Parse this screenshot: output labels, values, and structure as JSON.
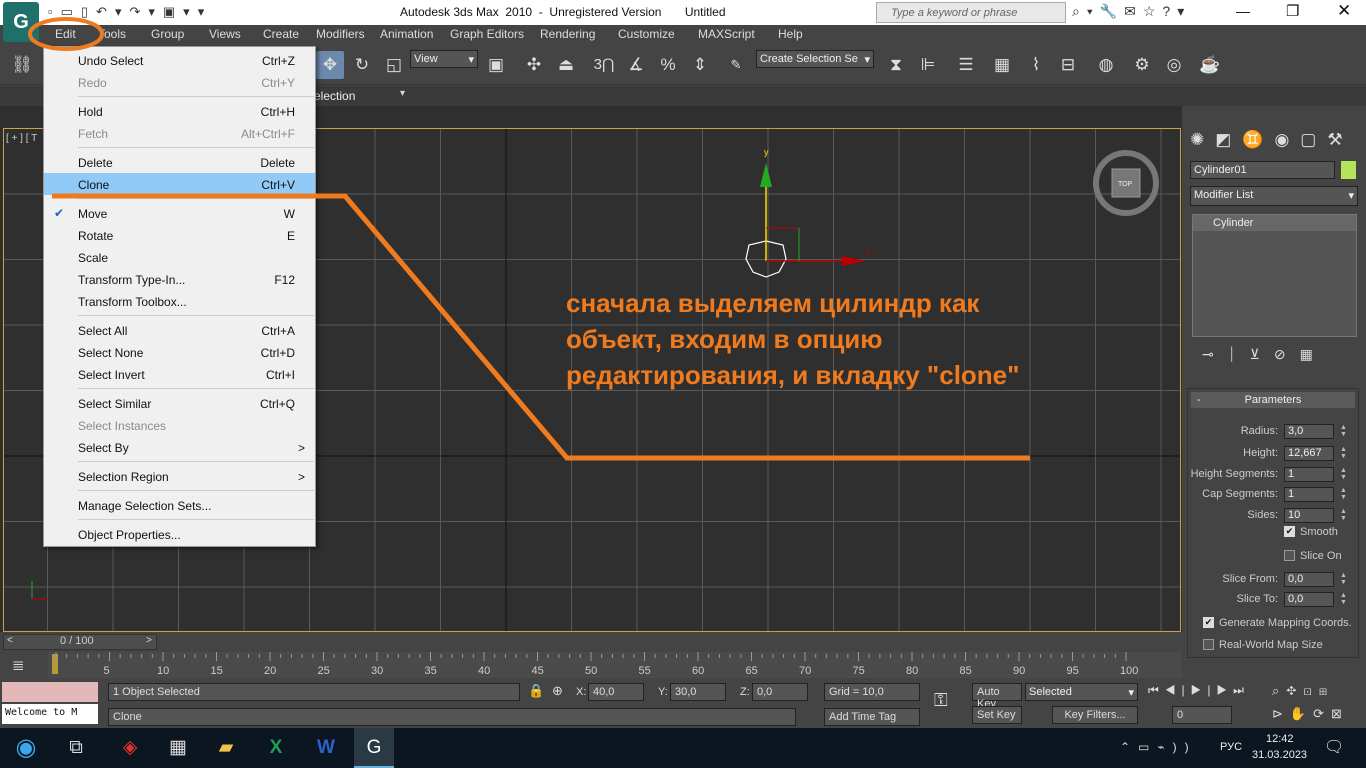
{
  "app": {
    "title": "Autodesk 3ds Max  2010  -  Unregistered Version       Untitled",
    "search_placeholder": "Type a keyword or phrase"
  },
  "menubar": [
    "Edit",
    "Tools",
    "Group",
    "Views",
    "Create",
    "Modifiers",
    "Animation",
    "Graph Editors",
    "Rendering",
    "Customize",
    "MAXScript",
    "Help"
  ],
  "toolbar": {
    "view_dropdown": "View",
    "selection_set": "Create Selection Se",
    "snap_label": "3",
    "ribbon_label": "Selection"
  },
  "edit_menu": [
    {
      "label": "Undo Select",
      "shortcut": "Ctrl+Z"
    },
    {
      "label": "Redo",
      "shortcut": "Ctrl+Y",
      "disabled": true
    },
    {
      "label": "Hold",
      "shortcut": "Ctrl+H"
    },
    {
      "label": "Fetch",
      "shortcut": "Alt+Ctrl+F",
      "disabled": true
    },
    {
      "label": "Delete",
      "shortcut": "Delete"
    },
    {
      "label": "Clone",
      "shortcut": "Ctrl+V",
      "highlighted": true
    },
    {
      "label": "Move",
      "shortcut": "W",
      "checked": true
    },
    {
      "label": "Rotate",
      "shortcut": "E"
    },
    {
      "label": "Scale",
      "shortcut": ""
    },
    {
      "label": "Transform Type-In...",
      "shortcut": "F12"
    },
    {
      "label": "Transform Toolbox...",
      "shortcut": ""
    },
    {
      "label": "Select All",
      "shortcut": "Ctrl+A"
    },
    {
      "label": "Select None",
      "shortcut": "Ctrl+D"
    },
    {
      "label": "Select Invert",
      "shortcut": "Ctrl+I"
    },
    {
      "label": "Select Similar",
      "shortcut": "Ctrl+Q"
    },
    {
      "label": "Select Instances",
      "shortcut": "",
      "disabled": true
    },
    {
      "label": "Select By",
      "shortcut": ">"
    },
    {
      "label": "Selection Region",
      "shortcut": ">"
    },
    {
      "label": "Manage Selection Sets...",
      "shortcut": ""
    },
    {
      "label": "Object Properties...",
      "shortcut": ""
    }
  ],
  "viewport": {
    "label": "[ + ] [ T",
    "viewcube": "TOP",
    "axis_x": "x",
    "axis_y": "y",
    "axis_z": "z"
  },
  "annotation": {
    "text": "сначала выделяем цилиндр как объект, входим в опцию редактирования, и вкладку \"clone\""
  },
  "command_panel": {
    "object_name": "Cylinder01",
    "modifier_list": "Modifier List",
    "stack_item": "Cylinder",
    "rollout_title": "Parameters",
    "rollout_toggle": "-",
    "params": [
      {
        "label": "Radius:",
        "value": "3,0"
      },
      {
        "label": "Height:",
        "value": "12,667"
      },
      {
        "label": "Height Segments:",
        "value": "1"
      },
      {
        "label": "Cap Segments:",
        "value": "1"
      },
      {
        "label": "Sides:",
        "value": "10"
      }
    ],
    "smooth": "Smooth",
    "slice_on": "Slice On",
    "slice_from": "Slice From:",
    "slice_from_val": "0,0",
    "slice_to": "Slice To:",
    "slice_to_val": "0,0",
    "gen_mapping": "Generate Mapping Coords.",
    "real_world": "Real-World Map Size"
  },
  "timeline": {
    "frame": "0 / 100",
    "ticks": [
      "5",
      "10",
      "15",
      "20",
      "25",
      "30",
      "35",
      "40",
      "45",
      "50",
      "55",
      "60",
      "65",
      "70",
      "75",
      "80",
      "85",
      "90",
      "95",
      "100"
    ]
  },
  "status": {
    "selected": "1 Object Selected",
    "prompt": "Clone",
    "listener": "Welcome to M",
    "x_label": "X:",
    "x": "40,0",
    "y_label": "Y:",
    "y": "30,0",
    "z_label": "Z:",
    "z": "0,0",
    "grid": "Grid = 10,0",
    "add_time_tag": "Add Time Tag",
    "auto_key": "Auto Key",
    "set_key": "Set Key",
    "selected_dd": "Selected",
    "key_filters": "Key Filters...",
    "frame_field": "0"
  },
  "taskbar": {
    "lang": "РУС",
    "time": "12:42",
    "date": "31.03.2023"
  }
}
